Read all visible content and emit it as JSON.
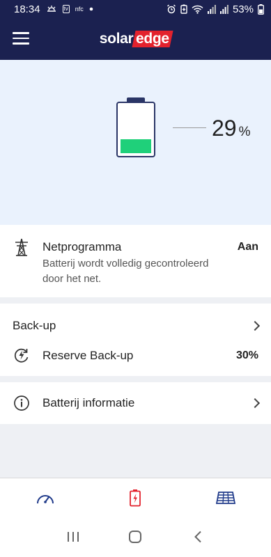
{
  "status_bar": {
    "time": "18:34",
    "battery_percent": "53%",
    "left_icons": [
      "weather-icon",
      "tv-icon",
      "nfc-icon",
      "dot-icon"
    ],
    "right_icons": [
      "alarm-icon",
      "battery-saver-icon",
      "wifi-icon",
      "signal-icon",
      "signal-icon",
      "battery-icon"
    ],
    "nfc_label": "nfc",
    "tv_label": "tv"
  },
  "header": {
    "logo_solar": "solar",
    "logo_edge": "edge"
  },
  "battery": {
    "percent": "29",
    "unit": "%",
    "fill_level": 0.29,
    "fill_color": "#1fd07a"
  },
  "grid_program": {
    "title": "Netprogramma",
    "value": "Aan",
    "description": "Batterij wordt volledig gecontroleerd door het net."
  },
  "backup": {
    "title": "Back-up",
    "reserve_title": "Reserve Back-up",
    "reserve_value": "30%"
  },
  "battery_info": {
    "title": "Batterij informatie"
  },
  "bottom_nav": {
    "items": [
      "dashboard-icon",
      "battery-icon",
      "solar-panel-icon"
    ],
    "active": "battery-icon"
  },
  "colors": {
    "header_bg": "#1b2150",
    "accent_red": "#e3222d",
    "nav_blue": "#1f3a8a"
  }
}
